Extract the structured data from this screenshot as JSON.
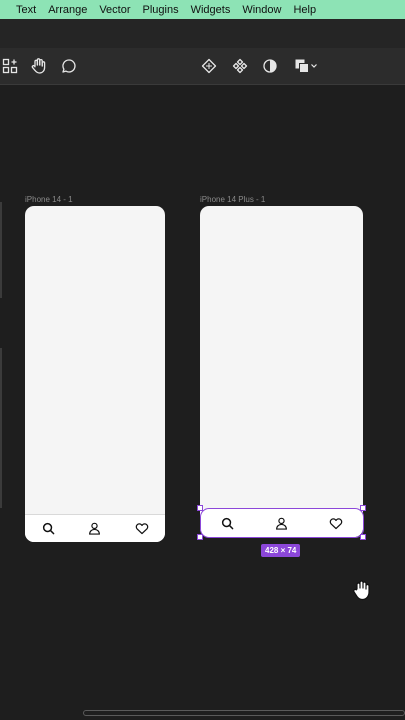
{
  "menubar": {
    "items": [
      "Text",
      "Arrange",
      "Vector",
      "Plugins",
      "Widgets",
      "Window",
      "Help"
    ]
  },
  "toolbar": {
    "left_tools": [
      "shapes-icon",
      "hand-icon",
      "comment-icon"
    ],
    "center_tools": [
      "component-edit-icon",
      "components-icon",
      "contrast-icon",
      "boolean-icon",
      "chevron-down-icon"
    ]
  },
  "frames": [
    {
      "label": "iPhone 14 - 1",
      "tabs": [
        "search-icon",
        "user-icon",
        "heart-icon"
      ]
    },
    {
      "label": "iPhone 14 Plus - 1",
      "tabs": [
        "search-icon",
        "user-icon",
        "heart-icon"
      ]
    }
  ],
  "selection": {
    "dimensions": "428 × 74"
  },
  "colors": {
    "menubar": "#8de3b5",
    "canvas": "#1e1e1e",
    "selection": "#8c47d9",
    "frame_fill": "#f5f5f5"
  }
}
